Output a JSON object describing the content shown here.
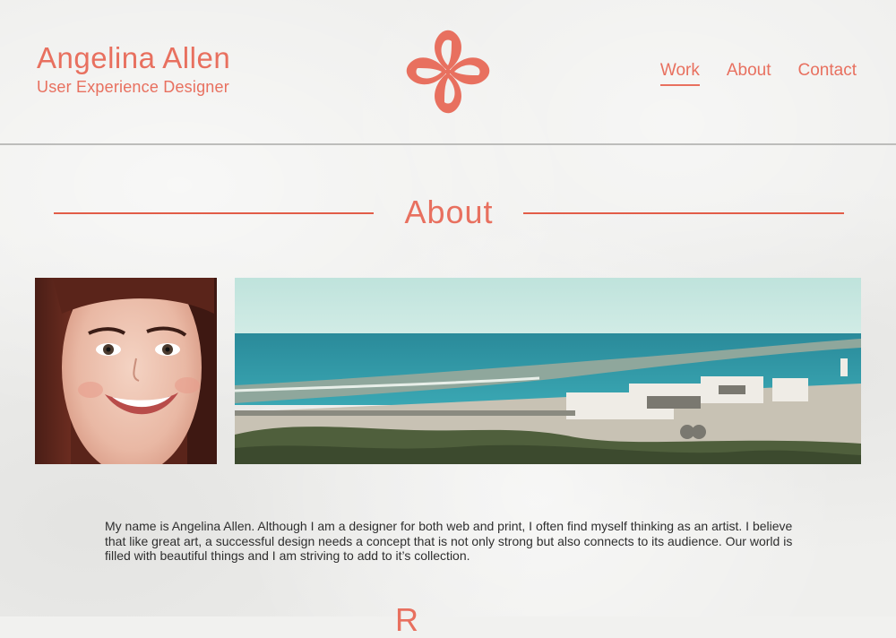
{
  "header": {
    "name": "Angelina Allen",
    "subtitle": "User Experience Designer",
    "logo_icon": "quatrefoil-logo-icon",
    "accent_color": "#e8705f"
  },
  "nav": {
    "items": [
      {
        "label": "Work",
        "active": true
      },
      {
        "label": "About",
        "active": false
      },
      {
        "label": "Contact",
        "active": false
      }
    ]
  },
  "about": {
    "heading": "About",
    "portrait_image": "portrait-photo",
    "landscape_image": "harbor-landscape-photo",
    "bio": "My name is Angelina Allen. Although I am a designer for both web and print, I often find myself thinking as an artist. I believe that like great art, a successful design needs a concept that is not only strong but also connects to its audience. Our world is filled with beautiful things and I am striving to add to it’s collection."
  },
  "next_section": {
    "heading_partial": "R"
  }
}
